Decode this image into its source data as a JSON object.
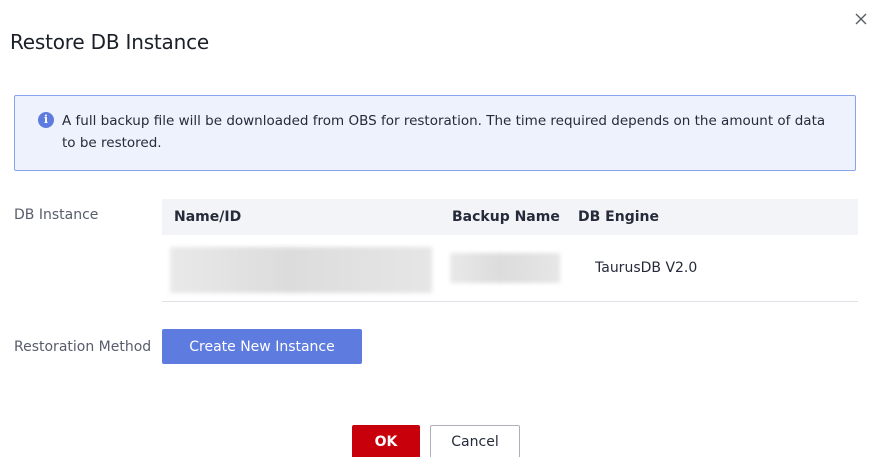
{
  "dialog": {
    "title": "Restore DB Instance",
    "close_icon": "close-icon"
  },
  "notice": {
    "icon": "info-icon",
    "icon_glyph": "i",
    "text": "A full backup file will be downloaded from OBS for restoration. The time required depends on the amount of data to be restored."
  },
  "db_instance": {
    "label": "DB Instance",
    "columns": [
      "Name/ID",
      "Backup Name",
      "DB Engine"
    ],
    "rows": [
      {
        "engine": "TaurusDB V2.0"
      }
    ]
  },
  "restoration": {
    "label": "Restoration Method",
    "button_label": "Create New Instance"
  },
  "footer": {
    "ok_label": "OK",
    "cancel_label": "Cancel"
  },
  "colors": {
    "primary": "#5e7ce0",
    "danger": "#c7000b",
    "notice_bg": "#eef2fc",
    "notice_border": "#8aa4ea"
  }
}
